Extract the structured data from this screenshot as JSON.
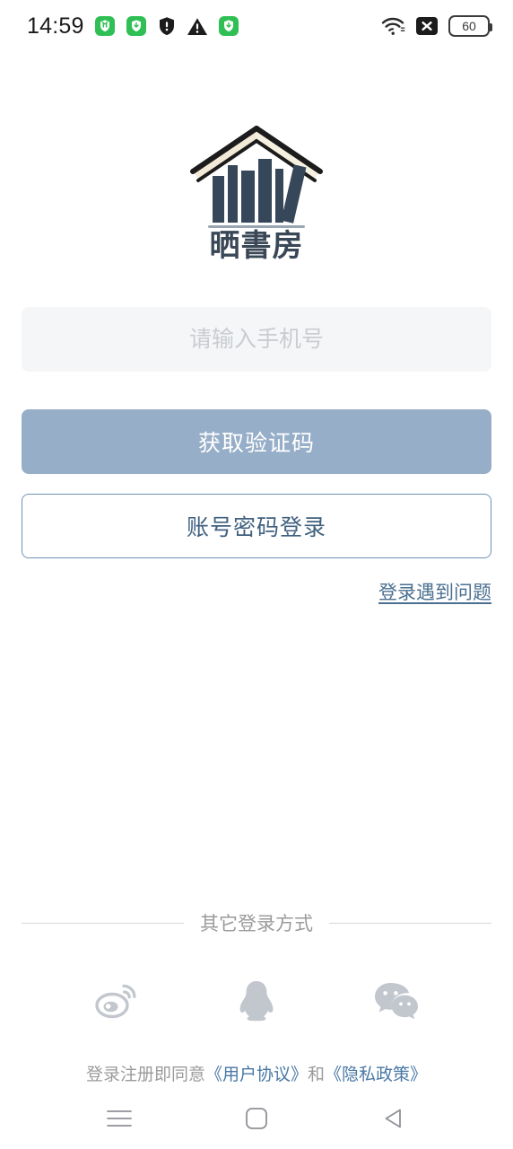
{
  "status_bar": {
    "clock": "14:59",
    "left_icons": [
      {
        "name": "green-shield-badge-icon",
        "label": "安全"
      },
      {
        "name": "green-shield-download-icon",
        "label": "下载"
      },
      {
        "name": "dark-shield-alert-icon",
        "label": "警告"
      },
      {
        "name": "warning-triangle-icon",
        "label": "注意"
      },
      {
        "name": "green-shield-download-icon-2",
        "label": "下载"
      }
    ],
    "right_icons": [
      {
        "name": "wifi-icon"
      },
      {
        "name": "no-sim-icon"
      }
    ],
    "battery_level": "60"
  },
  "logo": {
    "name": "shaishufang-logo",
    "wordmark": "晒書房",
    "roof_color": "#f2ead7",
    "roof_edge_color": "#1c1c1c",
    "book_color": "#36475a"
  },
  "form": {
    "phone_placeholder": "请输入手机号",
    "phone_value": "",
    "get_code_label": "获取验证码",
    "get_code_color": "#96aec8",
    "password_login_label": "账号密码登录",
    "password_login_border": "#6e93b5",
    "help_label": "登录遇到问题"
  },
  "other_login": {
    "divider_label": "其它登录方式",
    "methods": [
      {
        "name": "weibo-icon",
        "label": "微博"
      },
      {
        "name": "qq-icon",
        "label": "QQ"
      },
      {
        "name": "wechat-icon",
        "label": "微信"
      }
    ],
    "icon_color": "#c2c6cd"
  },
  "agreement": {
    "prefix": "登录注册即同意",
    "terms_link": "《用户协议》",
    "conjunction": "和",
    "privacy_link": "《隐私政策》",
    "link_color": "#4a78a5"
  },
  "navbar": {
    "buttons": [
      {
        "name": "recents-button",
        "label": "最近任务"
      },
      {
        "name": "home-button",
        "label": "主页"
      },
      {
        "name": "back-button",
        "label": "返回"
      }
    ],
    "icon_color": "#8e9196"
  }
}
